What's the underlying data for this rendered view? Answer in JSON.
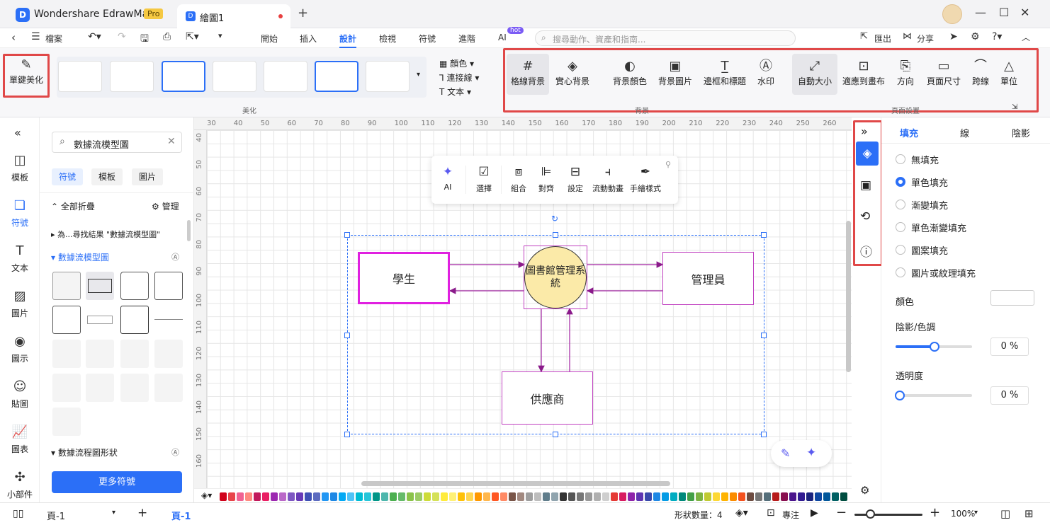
{
  "app": {
    "name": "Wondershare EdrawMax",
    "badge": "Pro"
  },
  "tab": {
    "title": "繪圖1"
  },
  "menu": {
    "file": "檔案",
    "items": [
      "開始",
      "插入",
      "設計",
      "檢視",
      "符號",
      "進階",
      "AI"
    ],
    "ai_badge": "hot",
    "search_placeholder": "搜尋動作、資產和指南...",
    "export": "匯出",
    "share": "分享"
  },
  "ribbon": {
    "beautify_one": "單鍵美化",
    "beautify_group": "美化",
    "side": {
      "color": "顏色",
      "connector": "連接線",
      "text": "文本"
    },
    "bg_buttons": [
      "格線背景",
      "實心背景",
      "背景顏色",
      "背景圖片",
      "邊框和標題",
      "水印"
    ],
    "bg_group": "背景",
    "page_buttons": [
      "自動大小",
      "適應到畫布",
      "方向",
      "頁面尺寸",
      "跨線",
      "單位"
    ],
    "page_group": "頁面設置"
  },
  "leftnav": [
    "模板",
    "符號",
    "文本",
    "圖片",
    "圖示",
    "貼圖",
    "圖表",
    "小部件"
  ],
  "panel": {
    "search_value": "數據流模型圖",
    "tabs": [
      "符號",
      "模板",
      "圖片"
    ],
    "collapse_all": "全部折疊",
    "manage": "管理",
    "search_result": "為...尋找結果 \"數據流模型圖\"",
    "category1": "數據流模型圖",
    "category2": "數據流程圖形狀",
    "more": "更多符號"
  },
  "ruler": {
    "top": [
      "30",
      "40",
      "50",
      "60",
      "70",
      "80",
      "90",
      "100",
      "110",
      "120",
      "130",
      "140",
      "150",
      "160",
      "170",
      "180",
      "190",
      "200",
      "210",
      "220",
      "230",
      "240",
      "250",
      "260"
    ],
    "left": [
      "40",
      "50",
      "60",
      "70",
      "80",
      "90",
      "100",
      "110",
      "120",
      "130",
      "140",
      "150",
      "160"
    ]
  },
  "floattb": [
    "AI",
    "選擇",
    "組合",
    "對齊",
    "設定",
    "流動動畫",
    "手繪樣式"
  ],
  "diagram": {
    "student": "學生",
    "system": "圖書館管理系統",
    "admin": "管理員",
    "supplier": "供應商"
  },
  "props": {
    "tabs": [
      "填充",
      "線",
      "陰影"
    ],
    "fills": [
      "無填充",
      "單色填充",
      "漸變填充",
      "單色漸變填充",
      "圖案填充",
      "圖片或紋理填充"
    ],
    "color_label": "顏色",
    "shade_label": "陰影/色調",
    "shade_value": "0 %",
    "opacity_label": "透明度",
    "opacity_value": "0 %"
  },
  "status": {
    "page": "頁-1",
    "page_tab": "頁-1",
    "shape_count": "形狀數量：4",
    "focus": "專注",
    "zoom": "100%"
  },
  "palette": [
    "#d0021b",
    "#e8444a",
    "#f06292",
    "#ff8a80",
    "#c2185b",
    "#e91e63",
    "#9c27b0",
    "#ba68c8",
    "#7e57c2",
    "#673ab7",
    "#3f51b5",
    "#5c6bc0",
    "#2196f3",
    "#1e88e5",
    "#03a9f4",
    "#4fc3f7",
    "#00bcd4",
    "#26c6da",
    "#009688",
    "#4db6ac",
    "#4caf50",
    "#66bb6a",
    "#8bc34a",
    "#9ccc65",
    "#cddc39",
    "#d4e157",
    "#ffeb3b",
    "#fff176",
    "#ffc107",
    "#ffd54f",
    "#ff9800",
    "#ffb74d",
    "#ff5722",
    "#ff8a65",
    "#795548",
    "#a1887f",
    "#9e9e9e",
    "#bdbdbd",
    "#607d8b",
    "#90a4ae",
    "#333333",
    "#555555",
    "#777777",
    "#999999",
    "#b0b0b0",
    "#cfcfcf",
    "#e53935",
    "#d81b60",
    "#8e24aa",
    "#5e35b1",
    "#3949ab",
    "#1e88e5",
    "#039be5",
    "#00acc1",
    "#00897b",
    "#43a047",
    "#7cb342",
    "#c0ca33",
    "#fdd835",
    "#ffb300",
    "#fb8c00",
    "#f4511e",
    "#6d4c41",
    "#757575",
    "#546e7a",
    "#b71c1c",
    "#880e4f",
    "#4a148c",
    "#311b92",
    "#1a237e",
    "#0d47a1",
    "#01579b",
    "#006064",
    "#004d40",
    "#1b5e20",
    "#33691e",
    "#827717",
    "#f57f17",
    "#ff6f00",
    "#e65100",
    "#bf360c",
    "#3e2723",
    "#212121",
    "#263238",
    "#ffcdd2",
    "#f8bbd0",
    "#e1bee7",
    "#d1c4e9",
    "#c5cae9",
    "#bbdefb",
    "#b3e5fc",
    "#b2ebf2",
    "#b2dfdb",
    "#c8e6c9",
    "#dcedc8",
    "#f0f4c3",
    "#fff9c4",
    "#ffecb3",
    "#ffe0b2",
    "#ffccbc",
    "#d7ccc8",
    "#f5f5f5",
    "#cfd8dc",
    "#8d6e63",
    "#a0a0a0",
    "#444444",
    "#202020",
    "#101010"
  ]
}
